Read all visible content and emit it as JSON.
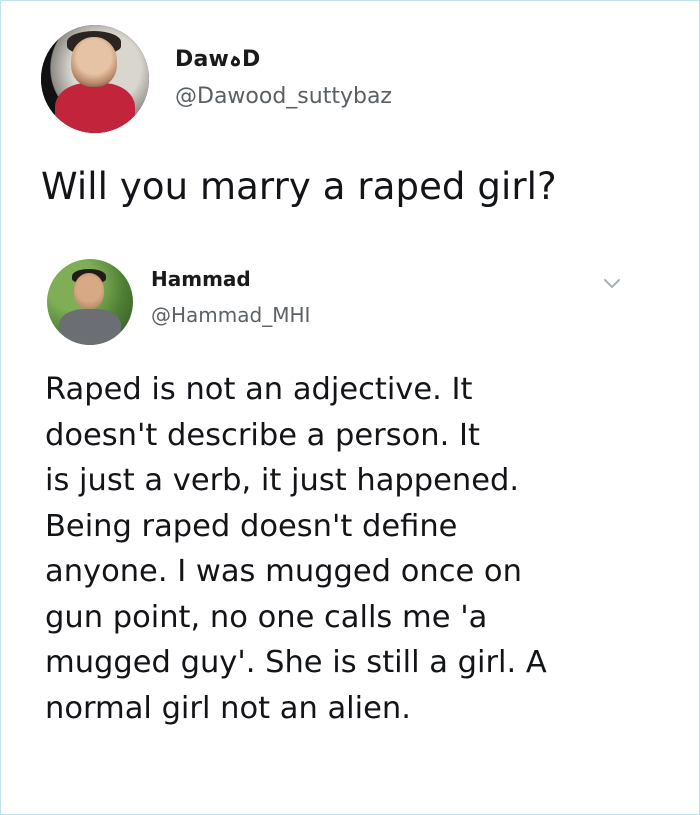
{
  "original_tweet": {
    "author": {
      "display_name": "DawہD",
      "handle": "@Dawood_suttybaz",
      "avatar": "avatar"
    },
    "text": "Will you marry a raped girl?"
  },
  "reply_tweet": {
    "author": {
      "display_name": "Hammad",
      "handle": "@Hammad_MHI",
      "avatar": "avatar"
    },
    "menu_icon": "chevron-down-icon",
    "text_lines": [
      "Raped is not an adjective. It",
      "doesn't describe a person. It",
      "is just a verb, it just happened.",
      "Being raped doesn't define",
      "anyone. I was mugged once on",
      "gun point, no one calls me 'a",
      "mugged guy'. She is still a girl. A",
      "normal girl not an alien."
    ]
  },
  "colors": {
    "text": "#121418",
    "handle": "#5a5f63",
    "chevron": "#a9b0b6",
    "border": "#bfe3ea"
  }
}
